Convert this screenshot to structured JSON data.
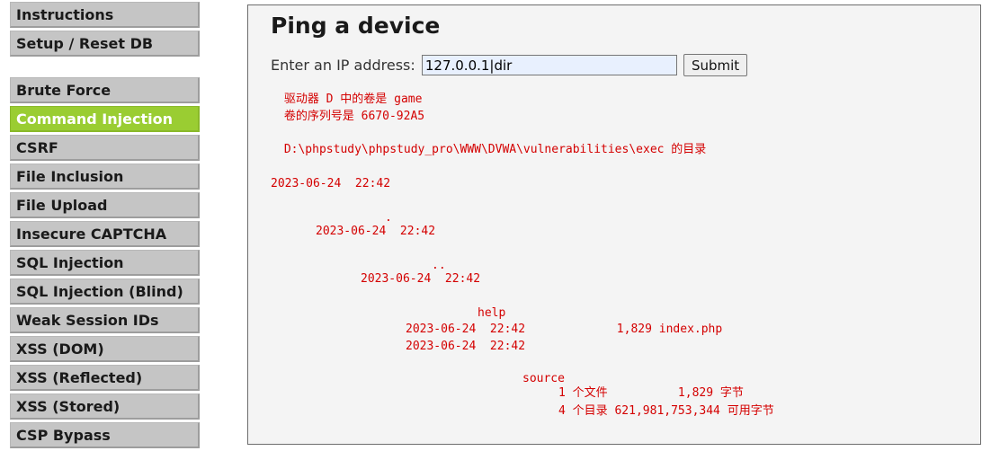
{
  "menu": {
    "top": [
      {
        "label": "Instructions"
      },
      {
        "label": "Setup / Reset DB"
      }
    ],
    "vulns": [
      {
        "label": "Brute Force",
        "selected": false
      },
      {
        "label": "Command Injection",
        "selected": true
      },
      {
        "label": "CSRF",
        "selected": false
      },
      {
        "label": "File Inclusion",
        "selected": false
      },
      {
        "label": "File Upload",
        "selected": false
      },
      {
        "label": "Insecure CAPTCHA",
        "selected": false
      },
      {
        "label": "SQL Injection",
        "selected": false
      },
      {
        "label": "SQL Injection (Blind)",
        "selected": false
      },
      {
        "label": "Weak Session IDs",
        "selected": false
      },
      {
        "label": "XSS (DOM)",
        "selected": false
      },
      {
        "label": "XSS (Reflected)",
        "selected": false
      },
      {
        "label": "XSS (Stored)",
        "selected": false
      },
      {
        "label": "CSP Bypass",
        "selected": false
      }
    ]
  },
  "main": {
    "title": "Ping a device",
    "form": {
      "label": "Enter an IP address:",
      "value": "127.0.0.1|dir",
      "submit_label": "Submit"
    },
    "output_lines": [
      " 驱动器 D 中的卷是 game",
      " 卷的序列号是 6670-92A5",
      " D:\\phpstudy\\phpstudy_pro\\WWW\\DVWA\\vulnerabilities\\exec 的目录",
      "2023-06-24  22:42",
      ".",
      "2023-06-24  22:42",
      "..",
      "2023-06-24  22:42",
      "help",
      "2023-06-24  22:42             1,829 index.php",
      "2023-06-24  22:42",
      "source",
      "1 个文件          1,829 字节",
      "4 个目录 621,981,753,344 可用字节"
    ]
  },
  "colors": {
    "selected_menu": "#9acd32",
    "output_text": "#d40000"
  }
}
